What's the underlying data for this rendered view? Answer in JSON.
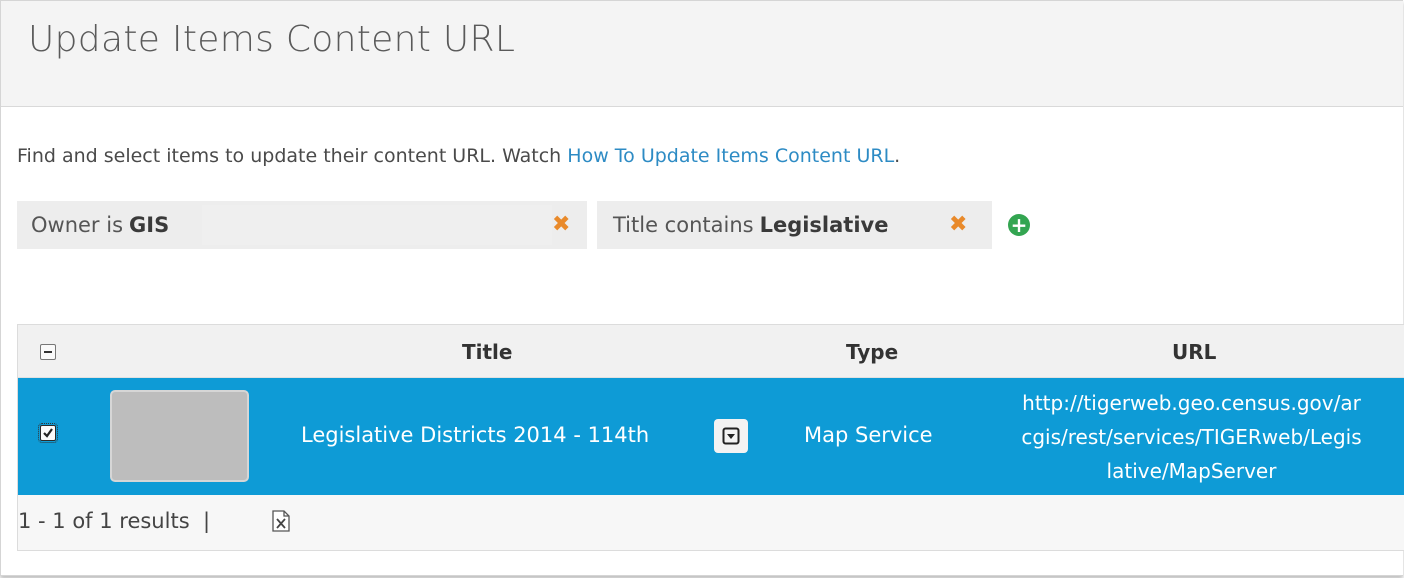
{
  "page_title": "Update Items Content URL",
  "intro": {
    "text": "Find and select items to update their content URL. Watch ",
    "link": "How To Update Items Content URL",
    "suffix": "."
  },
  "filters": [
    {
      "prefix": "Owner is",
      "value": "GIS",
      "remove_icon": "close-icon"
    },
    {
      "prefix": "Title contains",
      "value": "Legislative",
      "remove_icon": "close-icon"
    }
  ],
  "add_filter_icon": "plus-circle-icon",
  "table": {
    "columns": [
      "Title",
      "Type",
      "URL"
    ],
    "rows": [
      {
        "selected": true,
        "title": "Legislative Districts 2014 - 114th",
        "type": "Map Service",
        "url_lines": [
          "http://tigerweb.geo.census.gov/ar",
          "cgis/rest/services/TIGERweb/Legis",
          "lative/MapServer"
        ]
      }
    ],
    "results": "1 - 1 of 1 results",
    "results_sep": "|",
    "export_icon": "excel-export-icon"
  },
  "colors": {
    "selected_row": "#0e9bd6",
    "link": "#2d8bc4",
    "remove_icon": "#e98a2b",
    "add_button": "#33a551"
  }
}
